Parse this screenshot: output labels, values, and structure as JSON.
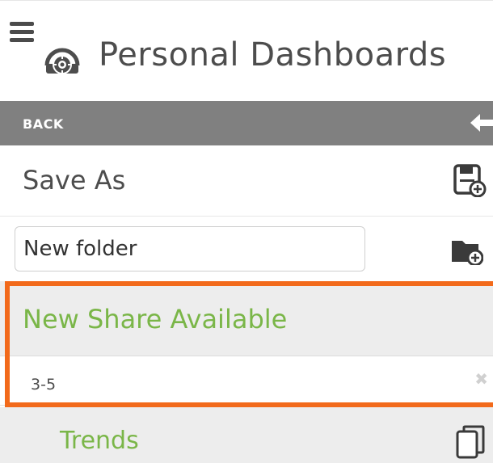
{
  "header": {
    "title": "Personal Dashboards",
    "menu_icon": "hamburger-icon",
    "dashboard_icon": "dashboard-gear-icon"
  },
  "back_bar": {
    "label": "BACK",
    "icon": "arrow-left-icon"
  },
  "save_as": {
    "label": "Save As",
    "icon": "save-plus-icon"
  },
  "new_folder": {
    "value": "New folder",
    "placeholder": "New folder",
    "icon": "folder-plus-icon"
  },
  "share": {
    "title": "New Share Available",
    "items": [
      {
        "name": "3-5",
        "dismiss_icon": "close-icon",
        "dismiss_glyph": "✖"
      }
    ]
  },
  "trends": {
    "label": "Trends",
    "icon": "copy-icon"
  },
  "colors": {
    "accent_green": "#7ab648",
    "back_bar_gray": "#808080",
    "highlight_orange": "#f26a1b",
    "section_bg": "#ededed",
    "text_dark": "#4d4d4d"
  }
}
